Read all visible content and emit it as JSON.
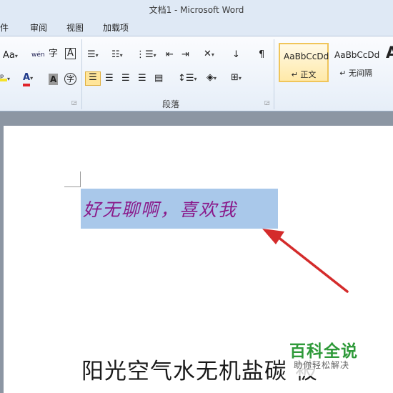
{
  "window": {
    "title": "文档1 - Microsoft Word"
  },
  "tabs": [
    "件",
    "审阅",
    "视图",
    "加载项"
  ],
  "ribbon": {
    "font_group": {
      "change_case": "Aa",
      "phonetic_guide": "wén",
      "char_border": "A",
      "font_color": "A",
      "char_shading": "A",
      "enclose_char": "字"
    },
    "paragraph_group": {
      "label": "段落"
    },
    "styles": [
      {
        "sample": "AaBbCcDd",
        "name": "↵ 正文",
        "active": true
      },
      {
        "sample": "AaBbCcDd",
        "name": "↵ 无间隔",
        "active": false
      },
      {
        "sample": "A",
        "name": "",
        "active": false
      }
    ]
  },
  "document": {
    "selected_text": "好无聊啊，喜欢我",
    "body_text": "阳光空气水无机盐碳  被"
  },
  "watermark": {
    "title": "百科全说",
    "subtitle": "助你轻松解决"
  },
  "colors": {
    "selection": "#a9c8ea",
    "selected_text": "#8a1a8a",
    "annotation_arrow": "#d42b2b",
    "font_color_bar": "#e0242a",
    "highlight_bar": "#f5e22a"
  }
}
